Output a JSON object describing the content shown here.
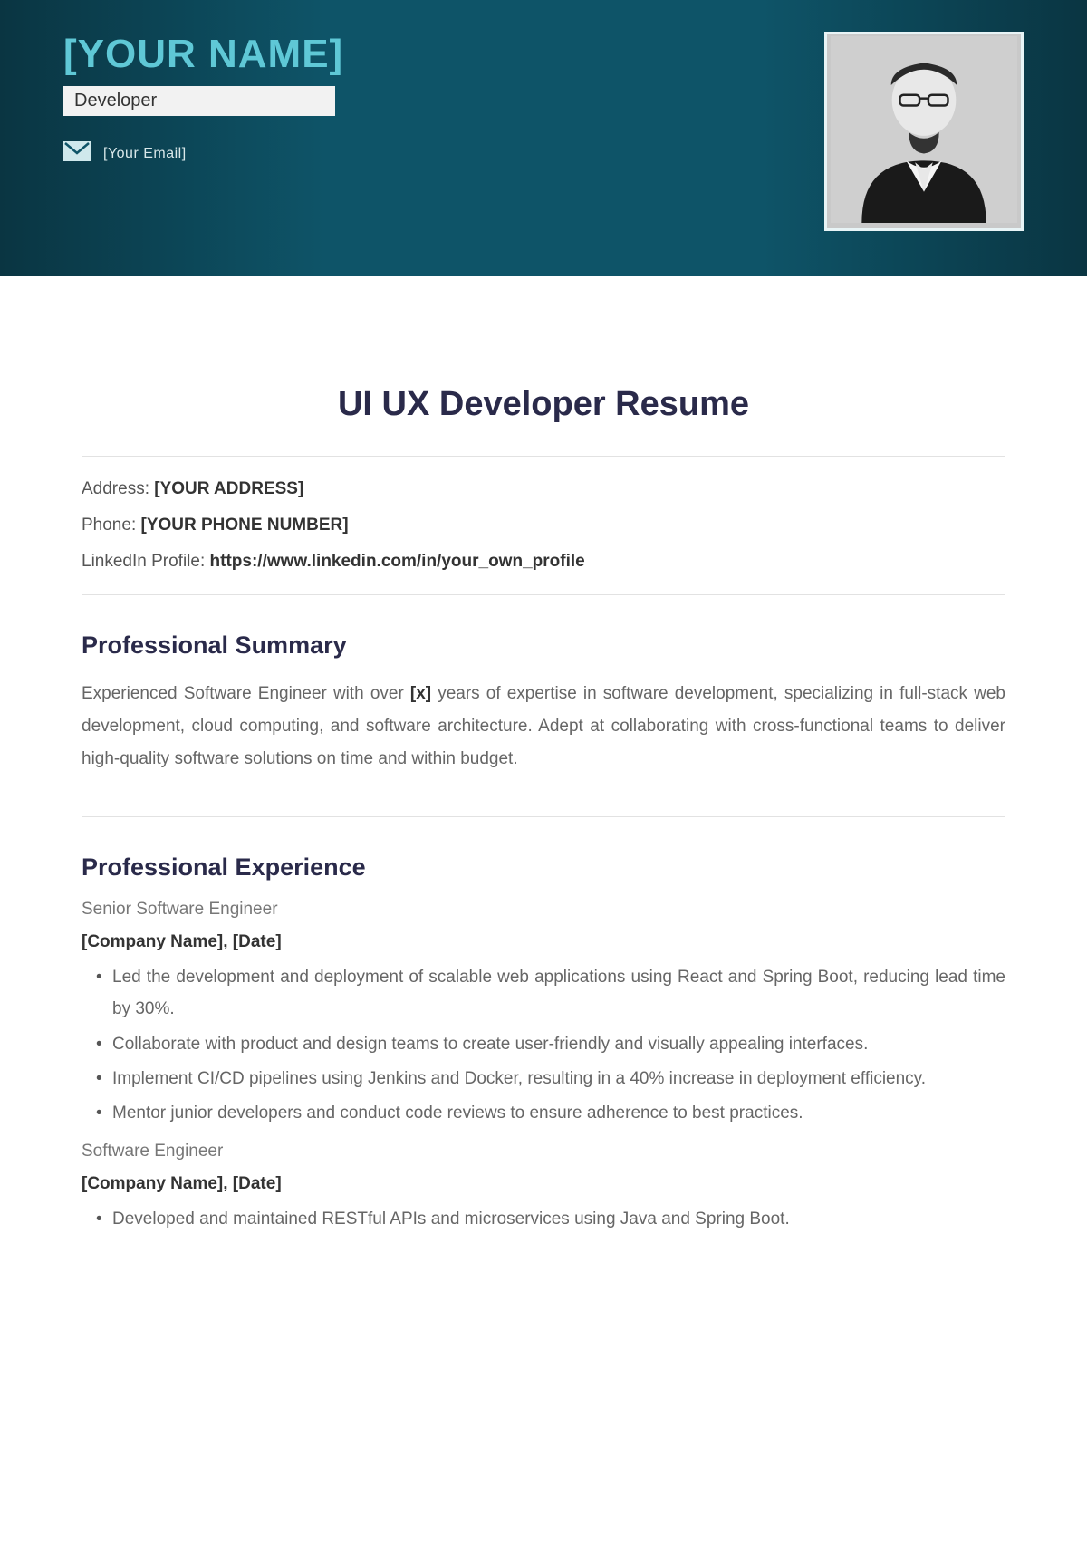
{
  "header": {
    "name": "[YOUR NAME]",
    "role": "Developer",
    "email_label": "[Your Email]"
  },
  "doc_title": "UI UX Developer Resume",
  "contact": {
    "address_label": "Address: ",
    "address_value": "[YOUR ADDRESS]",
    "phone_label": "Phone: ",
    "phone_value": "[YOUR PHONE NUMBER]",
    "linkedin_label": "LinkedIn Profile: ",
    "linkedin_value": "https://www.linkedin.com/in/your_own_profile"
  },
  "summary": {
    "heading": "Professional Summary",
    "body_pre": "Experienced Software Engineer with over ",
    "body_x": "[x]",
    "body_post": " years of expertise in software development, specializing in full-stack web development, cloud computing, and software architecture. Adept at collaborating with cross-functional teams to deliver high-quality software solutions on time and within budget."
  },
  "experience": {
    "heading": "Professional Experience",
    "jobs": [
      {
        "title": "Senior Software Engineer",
        "company_line": "[Company Name], [Date]",
        "bullets": [
          "Led the development and deployment of scalable web applications using React and Spring Boot, reducing lead time by 30%.",
          "Collaborate with product and design teams to create user-friendly and visually appealing interfaces.",
          "Implement CI/CD pipelines using Jenkins and Docker, resulting in a 40% increase in deployment efficiency.",
          "Mentor junior developers and conduct code reviews to ensure adherence to best practices."
        ]
      },
      {
        "title": "Software Engineer",
        "company_line": "[Company Name], [Date]",
        "bullets": [
          "Developed and maintained RESTful APIs and microservices using Java and Spring Boot."
        ]
      }
    ]
  }
}
